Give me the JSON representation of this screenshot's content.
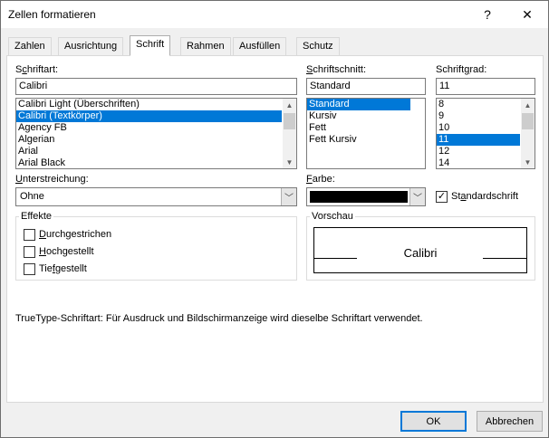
{
  "window": {
    "title": "Zellen formatieren",
    "help_glyph": "?",
    "close_glyph": "✕"
  },
  "tabs": [
    {
      "label": "Zahlen"
    },
    {
      "label": "Ausrichtung"
    },
    {
      "label": "Schrift"
    },
    {
      "label": "Rahmen"
    },
    {
      "label": "Ausfüllen"
    },
    {
      "label": "Schutz"
    }
  ],
  "font": {
    "label_pre": "S",
    "label_u": "c",
    "label_post": "hriftart:",
    "value": "Calibri",
    "items": [
      "Calibri Light (Überschriften)",
      "Calibri (Textkörper)",
      "Agency FB",
      "Algerian",
      "Arial",
      "Arial Black"
    ]
  },
  "style": {
    "label_pre": "",
    "label_u": "S",
    "label_post": "chriftschnitt:",
    "value": "Standard",
    "items": [
      "Standard",
      "Kursiv",
      "Fett",
      "Fett Kursiv"
    ]
  },
  "size": {
    "label_pre": "Schrift",
    "label_u": "g",
    "label_post": "rad:",
    "value": "11",
    "items": [
      "8",
      "9",
      "10",
      "11",
      "12",
      "14"
    ]
  },
  "underline": {
    "label_pre": "",
    "label_u": "U",
    "label_post": "nterstreichung:",
    "value": "Ohne"
  },
  "color": {
    "label_pre": "",
    "label_u": "F",
    "label_post": "arbe:",
    "swatch": "#000000"
  },
  "standard_font": {
    "label_pre": "St",
    "label_u": "a",
    "label_post": "ndardschrift",
    "checked": true
  },
  "effects": {
    "title": "Effekte",
    "items": [
      {
        "pre": "",
        "u": "D",
        "post": "urchgestrichen"
      },
      {
        "pre": "",
        "u": "H",
        "post": "ochgestellt"
      },
      {
        "pre": "Tie",
        "u": "f",
        "post": "gestellt"
      }
    ]
  },
  "preview": {
    "title": "Vorschau",
    "sample": "Calibri"
  },
  "info": "TrueType-Schriftart: Für Ausdruck und Bildschirmanzeige wird dieselbe Schriftart verwendet.",
  "buttons": {
    "ok": "OK",
    "cancel": "Abbrechen"
  },
  "colors": {
    "accent": "#0078d7",
    "selection_text": "#ffffff"
  }
}
